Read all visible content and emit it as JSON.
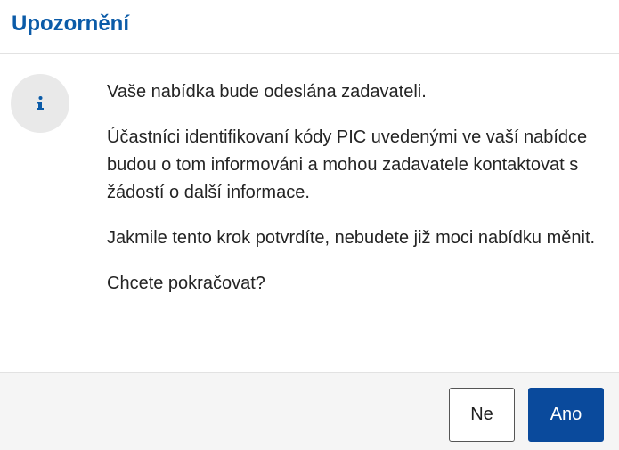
{
  "dialog": {
    "title": "Upozornění",
    "icon": "info-icon",
    "messages": [
      "Vaše nabídka bude odeslána zadavateli.",
      "Účastníci identifikovaní kódy PIC uvedenými ve vaší nabídce budou o tom informováni a mohou zadavatele kontaktovat s žádostí o další informace.",
      "Jakmile tento krok potvrdíte, nebudete již moci nabídku měnit.",
      "Chcete pokračovat?"
    ],
    "buttons": {
      "no_label": "Ne",
      "yes_label": "Ano"
    }
  },
  "colors": {
    "title": "#0b5ba8",
    "primary_button": "#0a4a9c",
    "icon_background": "#e9e9e9",
    "footer_background": "#f5f5f5"
  }
}
